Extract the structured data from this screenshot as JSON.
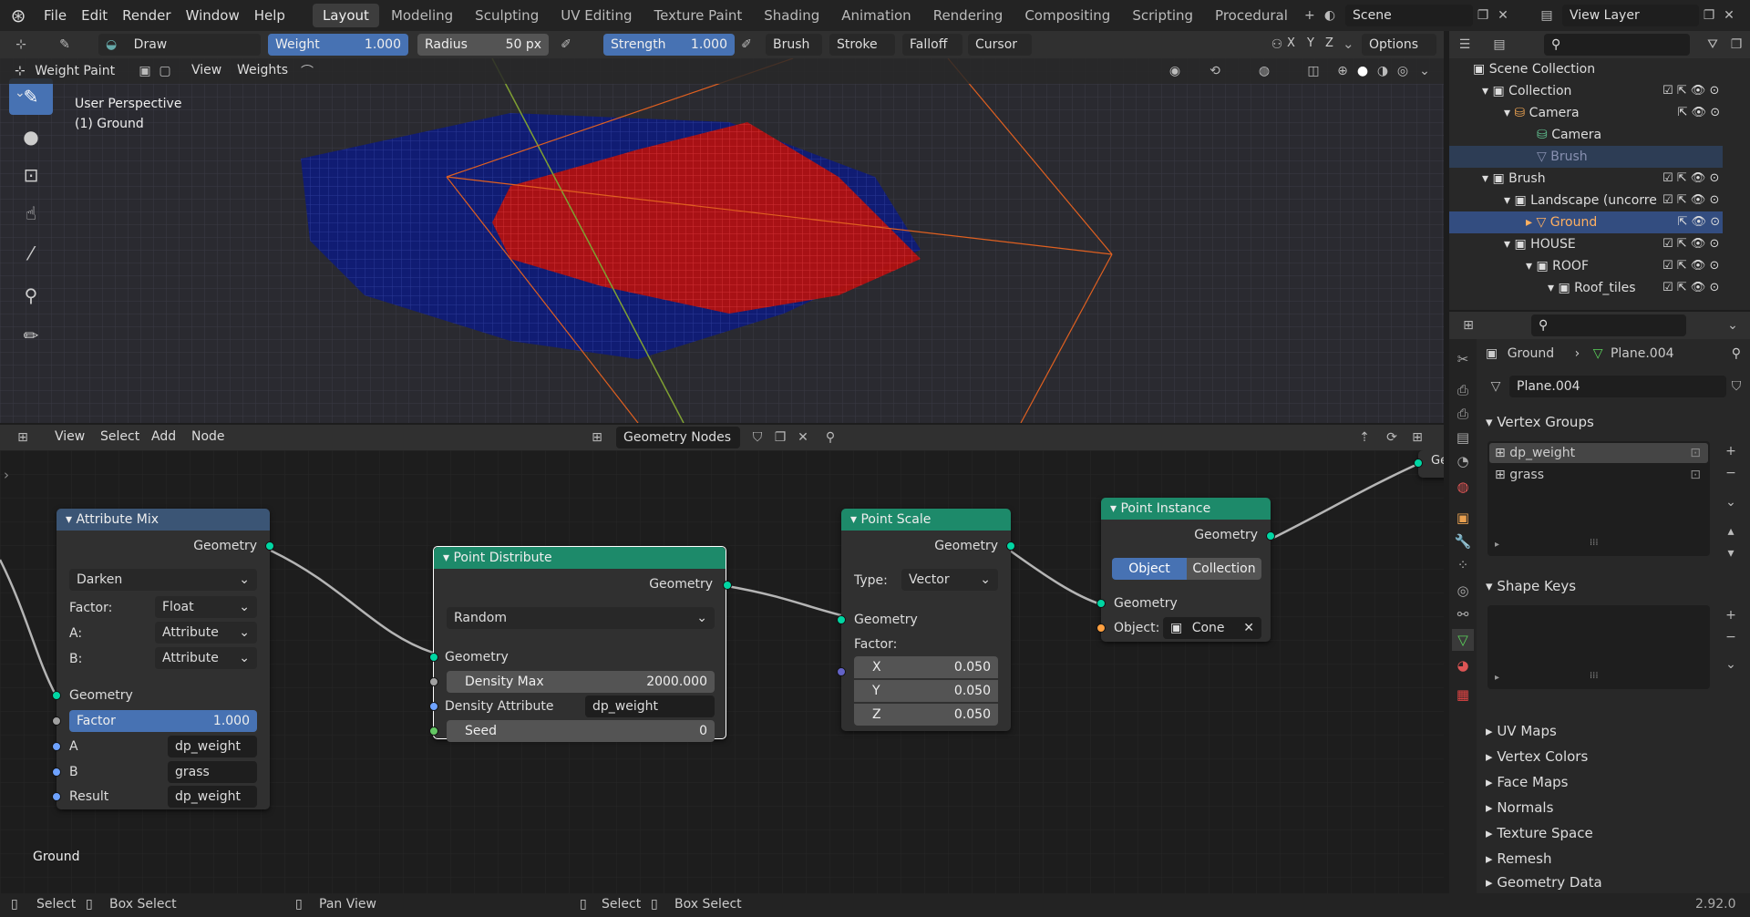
{
  "topbar": {
    "menus": [
      "File",
      "Edit",
      "Render",
      "Window",
      "Help"
    ],
    "tabs": [
      "Layout",
      "Modeling",
      "Sculpting",
      "UV Editing",
      "Texture Paint",
      "Shading",
      "Animation",
      "Rendering",
      "Compositing",
      "Scripting",
      "Procedural"
    ],
    "active_tab": "Layout",
    "scene": "Scene",
    "view_layer": "View Layer"
  },
  "tool_header": {
    "brush": "Draw",
    "weight_label": "Weight",
    "weight_value": "1.000",
    "radius_label": "Radius",
    "radius_value": "50 px",
    "strength_label": "Strength",
    "strength_value": "1.000",
    "brush_menu": "Brush",
    "stroke_menu": "Stroke",
    "falloff_menu": "Falloff",
    "cursor_menu": "Cursor",
    "axes": [
      "X",
      "Y",
      "Z"
    ],
    "options": "Options"
  },
  "viewport": {
    "mode": "Weight Paint",
    "menus": [
      "View",
      "Weights"
    ],
    "info_line1": "User Perspective",
    "info_line2": "(1) Ground"
  },
  "node_editor": {
    "menus": [
      "View",
      "Select",
      "Add",
      "Node"
    ],
    "tree_name": "Geometry Nodes",
    "footer_label": "Ground",
    "nodes": {
      "attribute_mix": {
        "title": "Attribute Mix",
        "out_geometry": "Geometry",
        "blend": "Darken",
        "factor_label": "Factor:",
        "factor_type": "Float",
        "a_label": "A:",
        "a_type": "Attribute",
        "b_label": "B:",
        "b_type": "Attribute",
        "in_geometry": "Geometry",
        "factor_field_label": "Factor",
        "factor_field_value": "1.000",
        "a": "A",
        "a_value": "dp_weight",
        "b": "B",
        "b_value": "grass",
        "result": "Result",
        "result_value": "dp_weight"
      },
      "point_distribute": {
        "title": "Point Distribute",
        "out_geometry": "Geometry",
        "method": "Random",
        "in_geometry": "Geometry",
        "density_max_label": "Density Max",
        "density_max_value": "2000.000",
        "density_attr_label": "Density Attribute",
        "density_attr_value": "dp_weight",
        "seed_label": "Seed",
        "seed_value": "0"
      },
      "point_scale": {
        "title": "Point Scale",
        "out_geometry": "Geometry",
        "type_label": "Type:",
        "type_value": "Vector",
        "in_geometry": "Geometry",
        "factor_label": "Factor:",
        "x_label": "X",
        "x_value": "0.050",
        "y_label": "Y",
        "y_value": "0.050",
        "z_label": "Z",
        "z_value": "0.050"
      },
      "point_instance": {
        "title": "Point Instance",
        "out_geometry": "Geometry",
        "object_btn": "Object",
        "collection_btn": "Collection",
        "in_geometry": "Geometry",
        "object_label": "Object:",
        "object_value": "Cone"
      },
      "group_output_label": "Ge"
    }
  },
  "outliner": {
    "rows": [
      {
        "label": "Scene Collection"
      },
      {
        "label": "Collection"
      },
      {
        "label": "Camera"
      },
      {
        "label": "Camera"
      },
      {
        "label": "Brush"
      },
      {
        "label": "Brush"
      },
      {
        "label": "Landscape (uncorre"
      },
      {
        "label": "Ground"
      },
      {
        "label": "HOUSE"
      },
      {
        "label": "ROOF"
      },
      {
        "label": "Roof_tiles"
      }
    ]
  },
  "properties": {
    "breadcrumb_object": "Ground",
    "breadcrumb_mesh": "Plane.004",
    "mesh_name": "Plane.004",
    "vertex_groups_title": "Vertex Groups",
    "vertex_groups": [
      "dp_weight",
      "grass"
    ],
    "shape_keys_title": "Shape Keys",
    "panels": [
      "UV Maps",
      "Vertex Colors",
      "Face Maps",
      "Normals",
      "Texture Space",
      "Remesh",
      "Geometry Data"
    ]
  },
  "statusbar": {
    "items": [
      "Select",
      "Box Select",
      "Pan View",
      "Select",
      "Box Select"
    ],
    "version": "2.92.0"
  }
}
